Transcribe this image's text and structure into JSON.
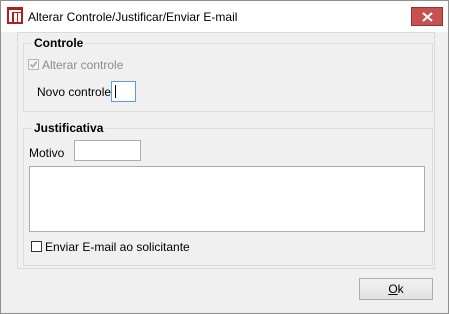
{
  "window": {
    "title": "Alterar Controle/Justificar/Enviar E-mail",
    "icon": "app-logo-icon",
    "close_icon": "close-icon"
  },
  "controle": {
    "legend": "Controle",
    "alterar_checkbox_label": "Alterar controle",
    "alterar_checked": true,
    "alterar_disabled": true,
    "novo_controle_label": "Novo controle",
    "novo_controle_value": ""
  },
  "justificativa": {
    "legend": "Justificativa",
    "motivo_label": "Motivo",
    "motivo_value": "",
    "text_value": ""
  },
  "email": {
    "checkbox_label": "Enviar E-mail ao solicitante",
    "checked": false
  },
  "ok_button": {
    "label_mnemonic": "O",
    "label_rest": "k"
  },
  "colors": {
    "close_button": "#c75050",
    "focus_border": "#569de5"
  }
}
